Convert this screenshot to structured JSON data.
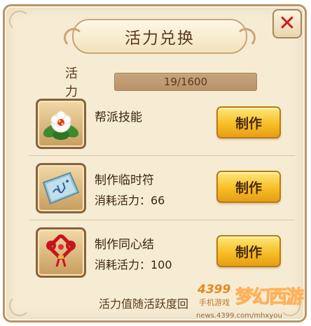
{
  "dialog": {
    "title": "活力兑换",
    "close_label": "✕"
  },
  "vitality": {
    "label": "活 力",
    "value": "19/1600",
    "fraction": 0.0119
  },
  "items": [
    {
      "name": "帮派技能",
      "cost": "",
      "icon": "lotus-flower-icon",
      "button": "制作"
    },
    {
      "name": "制作临时符",
      "cost": "消耗活力：66",
      "icon": "talisman-scroll-icon",
      "button": "制作"
    },
    {
      "name": "制作同心结",
      "cost": "消耗活力：100",
      "icon": "chinese-knot-icon",
      "button": "制作"
    }
  ],
  "footer": {
    "text": "活力值随活跃度回"
  },
  "watermark": {
    "brand_number": "4399",
    "brand_sub": "手机游戏",
    "url": "news.4399.com/mhxyou",
    "logo": "梦幻西游"
  },
  "colors": {
    "panel_bg": "#f6ecd4",
    "button_gold": "#f6bf27",
    "close_red": "#c51d1d"
  }
}
